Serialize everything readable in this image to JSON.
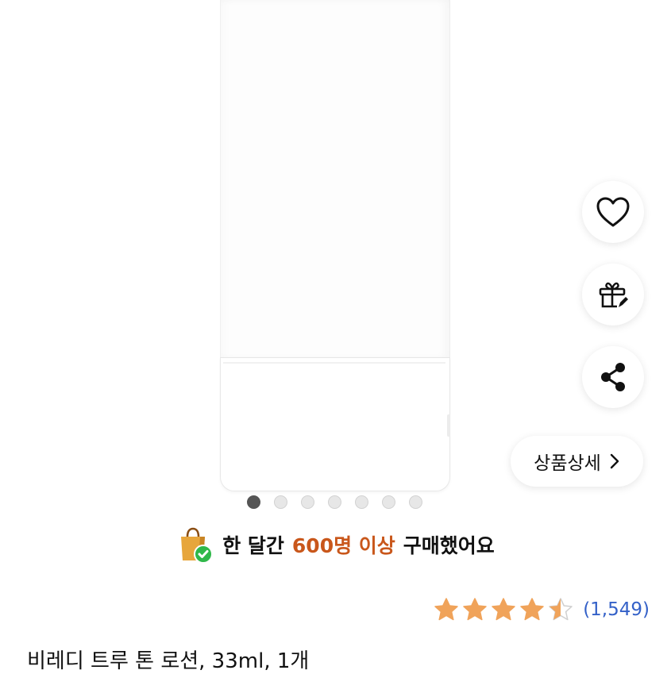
{
  "carousel": {
    "total": 7,
    "active_index": 0
  },
  "actions": {
    "heart_icon": "heart-outline-icon",
    "gift_icon": "gift-icon",
    "share_icon": "share-icon",
    "detail_label": "상품상세",
    "detail_icon": "chevron-right-icon"
  },
  "purchase": {
    "prefix": "한 달간",
    "highlight": "600명 이상",
    "suffix": "구매했어요",
    "icon": "shopping-bag-check-icon",
    "highlight_color": "#c9571b"
  },
  "rating": {
    "stars": 4.5,
    "max": 5,
    "count_text": "(1,549)",
    "star_color": "#f0a35a",
    "count_color": "#3461c8"
  },
  "product": {
    "title": "비레디 트루 톤 로션, 33ml, 1개"
  }
}
